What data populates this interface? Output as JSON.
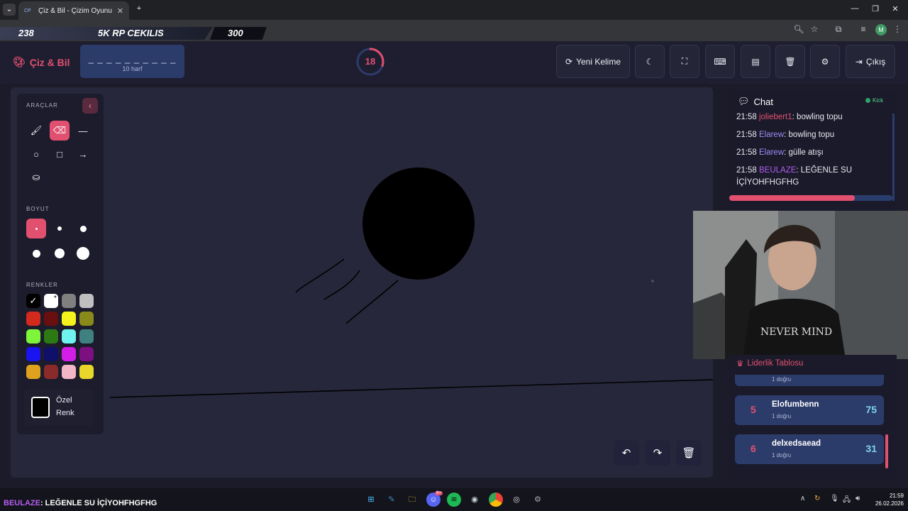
{
  "browser": {
    "tab_title": "Çiz & Bil - Çizim Oyunu",
    "tab_favicon": "CP",
    "avatar_letter": "M"
  },
  "stream_overlay": {
    "left_value": "238",
    "title": "5K RP CEKILIS",
    "right_value": "300",
    "ticker_user": "BEULAZE",
    "ticker_text": ": LEĞENLE SU İÇİYOHFHGFHG"
  },
  "app": {
    "logo": "Çiz & Bil",
    "word_dashes": "_ _ _ _ _ _ _ _ _ _",
    "word_hint": "10 harf",
    "timer": "18",
    "timer_fraction": 0.3,
    "new_word_label": "Yeni Kelime",
    "logout_label": "Çıkış"
  },
  "toolbar_icons": [
    "moon-icon",
    "fullscreen-icon",
    "keyboard-icon",
    "archive-icon",
    "trash-icon",
    "gear-icon"
  ],
  "tools": {
    "section_tools": "ARAÇLAR",
    "section_size": "BOYUT",
    "section_colors": "RENKLER",
    "custom_color_line1": "Özel",
    "custom_color_line2": "Renk",
    "items": [
      "brush-icon",
      "eraser-icon",
      "line-icon",
      "circle-icon",
      "square-icon",
      "arrow-icon",
      "bucket-icon"
    ],
    "active_tool": "eraser-icon",
    "colors": [
      "#000000",
      "#ffffff",
      "#808080",
      "#c0c0c0",
      "#d42a1e",
      "#6a0f0f",
      "#f5f21e",
      "#8a8a1a",
      "#7ef53a",
      "#2d7a14",
      "#6ff3ef",
      "#3f8080",
      "#1a14f0",
      "#10106a",
      "#d31ee8",
      "#7d1080",
      "#dfa21e",
      "#8a2a2a",
      "#f2b6c6",
      "#e8d62a"
    ],
    "custom_color": "#000000"
  },
  "chat": {
    "title": "Chat",
    "source": "Kick",
    "messages": [
      {
        "time": "21:58",
        "user": "joliebert1",
        "user_color": "#e2506f",
        "text": ": bowling topu"
      },
      {
        "time": "21:58",
        "user": "Elarew",
        "user_color": "#9d8cf5",
        "text": ": bowling topu"
      },
      {
        "time": "21:58",
        "user": "Elarew",
        "user_color": "#9d8cf5",
        "text": ": gülle atışı"
      },
      {
        "time": "21:58",
        "user": "BEULAZE",
        "user_color": "#b35ef0",
        "text": ": LEĞENLE SU İÇİYOHFHGFHG"
      }
    ],
    "progress": 0.77
  },
  "leaderboard": {
    "title": "Liderlik Tablosu",
    "partial_row_sub": "1 doğru",
    "rows": [
      {
        "rank": "5",
        "name": "Elofumbenn",
        "sub": "1 doğru",
        "points": "75"
      },
      {
        "rank": "6",
        "name": "delxedsaead",
        "sub": "1 doğru",
        "points": "31"
      }
    ]
  },
  "taskbar": {
    "time": "21:59",
    "date": "26.02.2026",
    "discord_badge": "9+"
  }
}
